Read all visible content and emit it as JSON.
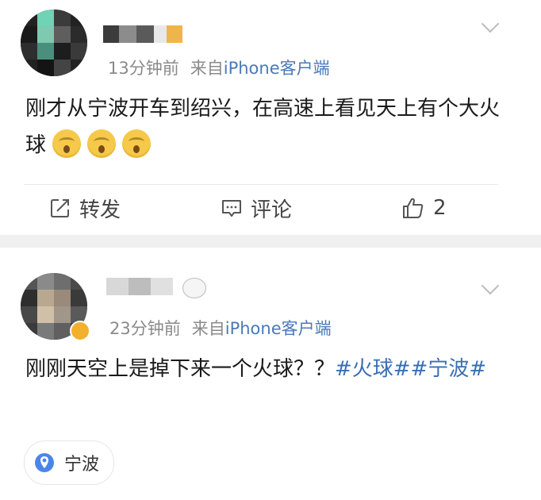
{
  "post1": {
    "time": "13分钟前",
    "source_prefix": "来自",
    "source_device": "iPhone客户端",
    "text": "刚才从宁波开车到绍兴，在高速上看见天上有个大火球",
    "emoji_icon": "astonished-face-emoji",
    "actions": {
      "repost_label": "转发",
      "comment_label": "评论",
      "like_count": "2"
    }
  },
  "post2": {
    "time": "23分钟前",
    "source_prefix": "来自",
    "source_device": "iPhone客户端",
    "text_main": "刚刚天空上是掉下来一个火球？？",
    "hashtag1": "#火球#",
    "hashtag2": "#宁波#",
    "location": "宁波"
  },
  "colors": {
    "link_blue": "#3a6fb3",
    "meta_gray": "#8a8a8a",
    "location_pin": "#4a86e8",
    "separator": "#f0f0f0"
  }
}
